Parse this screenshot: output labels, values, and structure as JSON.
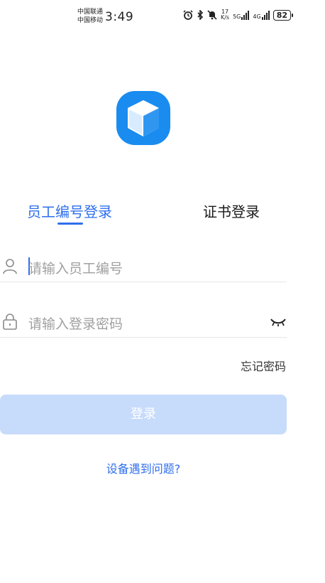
{
  "status_bar": {
    "carrier_1": "中国联通",
    "carrier_2": "中国移动",
    "time": "3:49",
    "speed_value": "17",
    "speed_unit": "K/s",
    "net_1": "5G",
    "net_2": "4G",
    "battery": "82",
    "icons": [
      "alarm-icon",
      "bluetooth-icon",
      "mute-icon",
      "signal-icon",
      "battery-icon"
    ]
  },
  "tabs": {
    "employee_login": "员工编号登录",
    "certificate_login": "证书登录",
    "active": "employee_login"
  },
  "form": {
    "employee_placeholder": "请输入员工编号",
    "password_placeholder": "请输入登录密码"
  },
  "forgot_password": "忘记密码",
  "login_button": "登录",
  "device_problem": "设备遇到问题?",
  "colors": {
    "accent": "#2f6fed",
    "button_disabled": "#c7dbfb",
    "logo": "#1a8cf0"
  }
}
